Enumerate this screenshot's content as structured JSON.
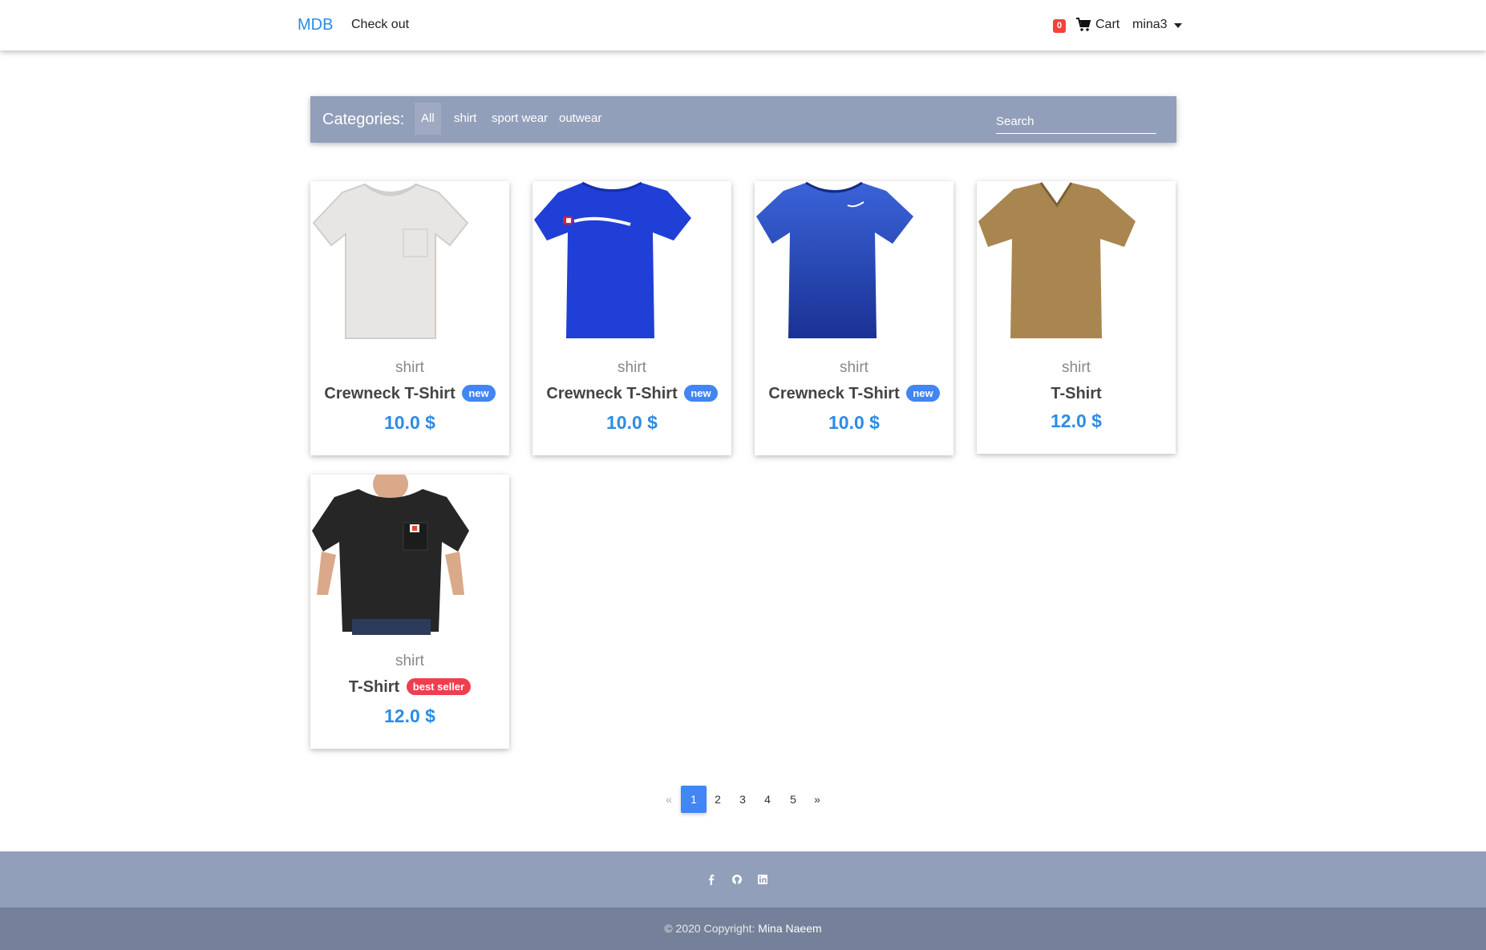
{
  "nav": {
    "brand": "MDB",
    "checkout": "Check out",
    "cart_count": "0",
    "cart_label": "Cart",
    "user": "mina3"
  },
  "categories": {
    "title": "Categories:",
    "items": [
      "All",
      "shirt",
      "sport wear",
      "outwear"
    ],
    "search_placeholder": "Search"
  },
  "products": [
    {
      "category": "shirt",
      "name": "Crewneck T-Shirt",
      "badge": "new",
      "badge_color": "#4285f4",
      "price": "10.0 $",
      "shirt_color": "#e8e6e4",
      "icon": "white-tshirt-icon"
    },
    {
      "category": "shirt",
      "name": "Crewneck T-Shirt",
      "badge": "new",
      "badge_color": "#4285f4",
      "price": "10.0 $",
      "shirt_color": "#1f3fd6",
      "icon": "blue-champion-tshirt-icon"
    },
    {
      "category": "shirt",
      "name": "Crewneck T-Shirt",
      "badge": "new",
      "badge_color": "#4285f4",
      "price": "10.0 $",
      "shirt_color": "#1d3fb0",
      "icon": "blue-nike-tshirt-icon"
    },
    {
      "category": "shirt",
      "name": "T-Shirt",
      "badge": "",
      "badge_color": "",
      "price": "12.0 $",
      "shirt_color": "#a98650",
      "icon": "brown-tshirt-icon"
    },
    {
      "category": "shirt",
      "name": "T-Shirt",
      "badge": "best seller",
      "badge_color": "#ef3f4f",
      "price": "12.0 $",
      "shirt_color": "#262626",
      "icon": "black-tshirt-icon"
    }
  ],
  "pagination": {
    "prev": "«",
    "pages": [
      "1",
      "2",
      "3",
      "4",
      "5"
    ],
    "next": "»",
    "current": "1"
  },
  "footer": {
    "icons": [
      "facebook-icon",
      "github-icon",
      "linkedin-icon"
    ],
    "copyright_prefix": "© 2020 Copyright:",
    "copyright_name": "Mina Naeem"
  },
  "colors": {
    "accent": "#2b8ce6",
    "catbar": "#929fba",
    "footer": "#929fba",
    "footer_bottom": "#75819a"
  }
}
